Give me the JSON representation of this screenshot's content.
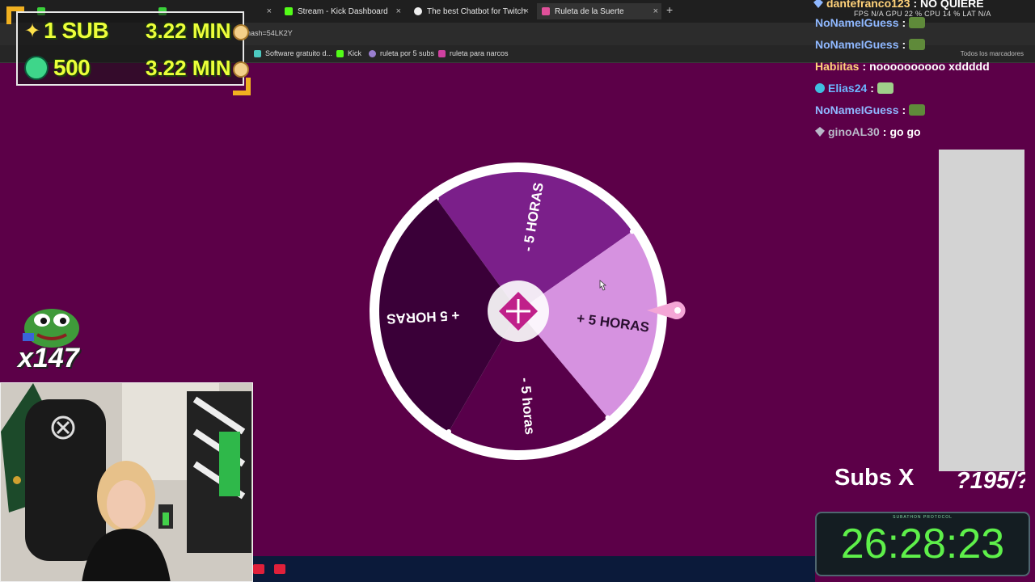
{
  "browser": {
    "tabs": [
      {
        "label": "",
        "close": "×"
      },
      {
        "label": "",
        "close": "×"
      },
      {
        "label": "Stream - Kick Dashboard",
        "close": "×"
      },
      {
        "label": "The best Chatbot for Twitch",
        "close": "×"
      },
      {
        "label": "Ruleta de la Suerte",
        "close": "×"
      }
    ],
    "new_tab": "+",
    "url": "?hash=54LK2Y",
    "bookmarks": [
      "Software gratuito d...",
      "Kick",
      "ruleta por 5 subs",
      "ruleta para narcos"
    ],
    "all_bookmarks": "Todos los marcadores"
  },
  "overlay_subs": {
    "row1_left": "1 SUB",
    "row1_right": "3.22 MIN",
    "row2_left": "500",
    "row2_right": "3.22 MIN"
  },
  "wheel": {
    "segments": [
      {
        "label": "- 5 HORAS",
        "color": "#7b1f8a"
      },
      {
        "label": "+ 5 HORAS",
        "color": "#d692e0"
      },
      {
        "label": "- 5 horas",
        "color": "#58004a"
      },
      {
        "label": "+ 5 HORAS",
        "color": "#3a0038"
      }
    ],
    "rim_color": "#ffffff"
  },
  "chat": {
    "top_line": {
      "user": "dantefranco123",
      "message": ": NO QUIERE"
    },
    "stats": "FPS N/A   GPU 22 %   CPU 14 %   LAT N/A",
    "messages": [
      {
        "user": "NoNameIGuess",
        "separator": " :",
        "message": "",
        "user_color": "#8fb8ff"
      },
      {
        "user": "NoNameIGuess",
        "separator": " :",
        "message": "",
        "user_color": "#8fb8ff"
      },
      {
        "user": "Habiitas",
        "separator": " :",
        "message": "noooooooooo xddddd",
        "user_color": "#ffd27a"
      },
      {
        "user": "Elias24",
        "separator": " :",
        "message": "",
        "user_color": "#6cb6ff"
      },
      {
        "user": "NoNameIGuess",
        "separator": " :",
        "message": "",
        "user_color": "#8fb8ff"
      },
      {
        "user": "ginoAL30",
        "separator": " :",
        "message": "go go",
        "user_color": "#b9b9c9"
      }
    ]
  },
  "subs_counter": {
    "label": "Subs X",
    "value": "?195/?"
  },
  "timer": {
    "title": "SUBATHON PROTOCOL",
    "value": "26:28:23",
    "color": "#5ef04a"
  },
  "multiplier": "x147",
  "colors": {
    "background": "#5c0048",
    "overlay_yellow": "#ecff3a",
    "corner_gold": "#f0b020"
  }
}
